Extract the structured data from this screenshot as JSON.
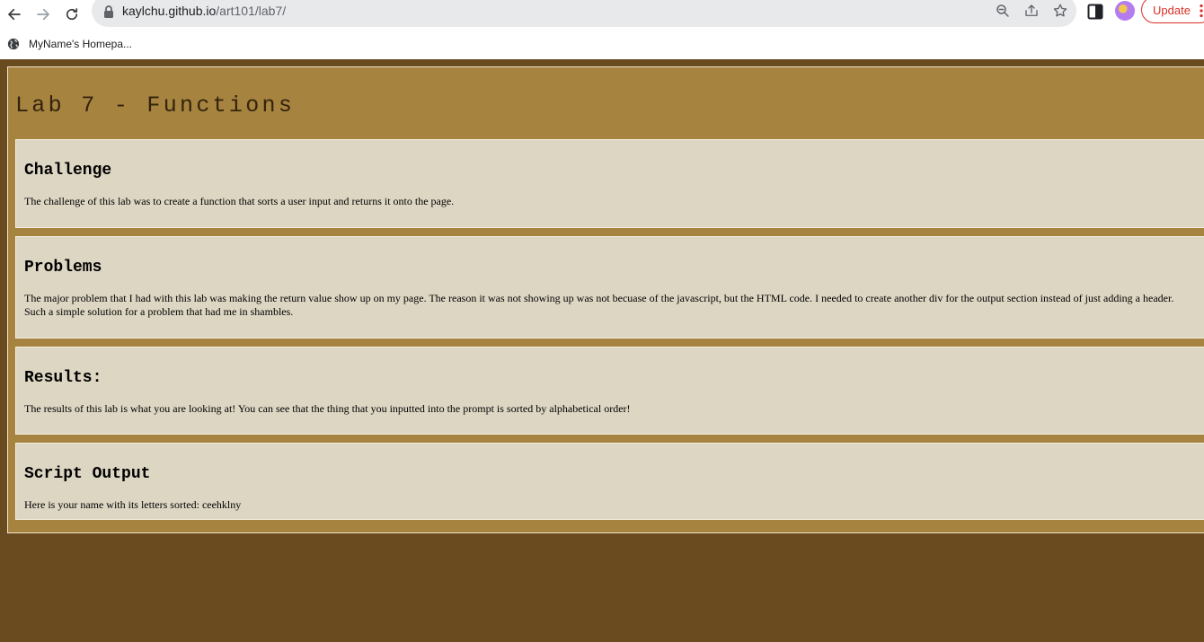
{
  "browser": {
    "url_host": "kaylchu.github.io",
    "url_path": "/art101/lab7/",
    "update_label": "Update",
    "bookmark_label": "MyName's Homepa..."
  },
  "page": {
    "title": "Lab 7 - Functions",
    "sections": [
      {
        "heading": "Challenge",
        "body": "The challenge of this lab was to create a function that sorts a user input and returns it onto the page."
      },
      {
        "heading": "Problems",
        "body": "The major problem that I had with this lab was making the return value show up on my page. The reason it was not showing up was not becuase of the javascript, but the HTML code. I needed to create another div for the output section instead of just adding a header. Such a simple solution for a problem that had me in shambles."
      },
      {
        "heading": "Results:",
        "body": "The results of this lab is what you are looking at! You can see that the thing that you inputted into the prompt is sorted by alphabetical order!"
      },
      {
        "heading": "Script Output",
        "body": "Here is your name with its letters sorted: ceehklny"
      }
    ]
  },
  "colors": {
    "outer_background": "#6a4a1f",
    "wrapper_background": "#a78340",
    "section_background": "#ddd6c3",
    "title_color": "#33230c"
  },
  "icons": {
    "back": "arrow-left",
    "forward": "arrow-right",
    "reload": "reload",
    "lock": "lock",
    "zoom": "magnifier-minus",
    "share": "share",
    "bookmark": "star",
    "side_panel": "side-panel",
    "menu": "three-dots",
    "bookmark_favicon": "globe"
  }
}
